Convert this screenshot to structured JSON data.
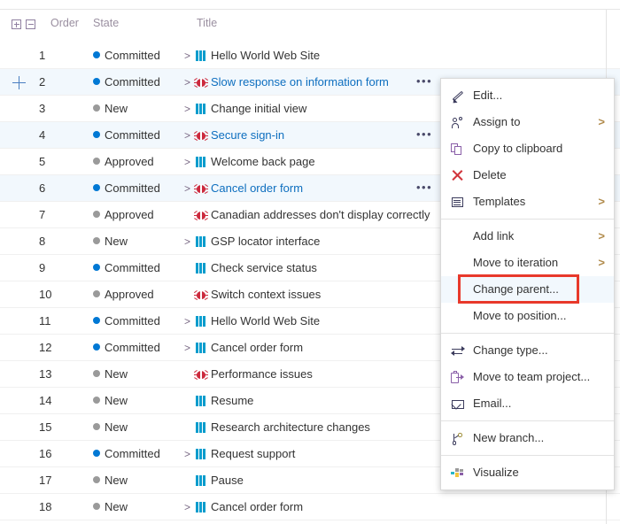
{
  "grid": {
    "header": {
      "expand_all_icon": "plus-box-icon",
      "collapse_all_icon": "minus-box-icon",
      "order_label": "Order",
      "state_label": "State",
      "title_label": "Title"
    },
    "state_colors": {
      "Committed": "#0078d4",
      "New": "#9a9a9a",
      "Approved": "#9a9a9a"
    },
    "rows": [
      {
        "order": "1",
        "state": "Committed",
        "chevron": ">",
        "type": "pbi",
        "title": "Hello World Web Site",
        "link": false,
        "ellipsis": "",
        "selected": false,
        "expander": false
      },
      {
        "order": "2",
        "state": "Committed",
        "chevron": ">",
        "type": "bug",
        "title": "Slow response on information form",
        "link": true,
        "ellipsis": "•••",
        "selected": true,
        "expander": true
      },
      {
        "order": "3",
        "state": "New",
        "chevron": ">",
        "type": "pbi",
        "title": "Change initial view",
        "link": false,
        "ellipsis": "",
        "selected": false,
        "expander": false
      },
      {
        "order": "4",
        "state": "Committed",
        "chevron": ">",
        "type": "bug",
        "title": "Secure sign-in",
        "link": true,
        "ellipsis": "•••",
        "selected": true,
        "expander": false
      },
      {
        "order": "5",
        "state": "Approved",
        "chevron": ">",
        "type": "pbi",
        "title": "Welcome back page",
        "link": false,
        "ellipsis": "",
        "selected": false,
        "expander": false
      },
      {
        "order": "6",
        "state": "Committed",
        "chevron": ">",
        "type": "bug",
        "title": "Cancel order form",
        "link": true,
        "ellipsis": "•••",
        "selected": true,
        "expander": false
      },
      {
        "order": "7",
        "state": "Approved",
        "chevron": "",
        "type": "bug",
        "title": "Canadian addresses don't display correctly",
        "link": false,
        "ellipsis": "",
        "selected": false,
        "expander": false
      },
      {
        "order": "8",
        "state": "New",
        "chevron": ">",
        "type": "pbi",
        "title": "GSP locator interface",
        "link": false,
        "ellipsis": "",
        "selected": false,
        "expander": false
      },
      {
        "order": "9",
        "state": "Committed",
        "chevron": "",
        "type": "pbi",
        "title": "Check service status",
        "link": false,
        "ellipsis": "",
        "selected": false,
        "expander": false
      },
      {
        "order": "10",
        "state": "Approved",
        "chevron": "",
        "type": "bug",
        "title": "Switch context issues",
        "link": false,
        "ellipsis": "",
        "selected": false,
        "expander": false
      },
      {
        "order": "11",
        "state": "Committed",
        "chevron": ">",
        "type": "pbi",
        "title": "Hello World Web Site",
        "link": false,
        "ellipsis": "",
        "selected": false,
        "expander": false
      },
      {
        "order": "12",
        "state": "Committed",
        "chevron": ">",
        "type": "pbi",
        "title": "Cancel order form",
        "link": false,
        "ellipsis": "",
        "selected": false,
        "expander": false
      },
      {
        "order": "13",
        "state": "New",
        "chevron": "",
        "type": "bug",
        "title": "Performance issues",
        "link": false,
        "ellipsis": "",
        "selected": false,
        "expander": false
      },
      {
        "order": "14",
        "state": "New",
        "chevron": "",
        "type": "pbi",
        "title": "Resume",
        "link": false,
        "ellipsis": "",
        "selected": false,
        "expander": false
      },
      {
        "order": "15",
        "state": "New",
        "chevron": "",
        "type": "pbi",
        "title": "Research architecture changes",
        "link": false,
        "ellipsis": "",
        "selected": false,
        "expander": false
      },
      {
        "order": "16",
        "state": "Committed",
        "chevron": ">",
        "type": "pbi",
        "title": "Request support",
        "link": false,
        "ellipsis": "",
        "selected": false,
        "expander": false
      },
      {
        "order": "17",
        "state": "New",
        "chevron": "",
        "type": "pbi",
        "title": "Pause",
        "link": false,
        "ellipsis": "",
        "selected": false,
        "expander": false
      },
      {
        "order": "18",
        "state": "New",
        "chevron": ">",
        "type": "pbi",
        "title": "Cancel order form",
        "link": false,
        "ellipsis": "",
        "selected": false,
        "expander": false
      }
    ]
  },
  "context_menu": {
    "highlight_color": "#e8392b",
    "items": [
      {
        "label": "Edit...",
        "icon": "pencil-icon",
        "submenu": "",
        "separator_after": false,
        "highlighted": false,
        "boxed": false
      },
      {
        "label": "Assign to",
        "icon": "person-add-icon",
        "submenu": ">",
        "separator_after": false,
        "highlighted": false,
        "boxed": false
      },
      {
        "label": "Copy to clipboard",
        "icon": "copy-icon",
        "submenu": "",
        "separator_after": false,
        "highlighted": false,
        "boxed": false
      },
      {
        "label": "Delete",
        "icon": "delete-x-icon",
        "submenu": "",
        "separator_after": false,
        "highlighted": false,
        "boxed": false
      },
      {
        "label": "Templates",
        "icon": "templates-icon",
        "submenu": ">",
        "separator_after": true,
        "highlighted": false,
        "boxed": false
      },
      {
        "label": "Add link",
        "icon": "",
        "submenu": ">",
        "separator_after": false,
        "highlighted": false,
        "boxed": false
      },
      {
        "label": "Move to iteration",
        "icon": "",
        "submenu": ">",
        "separator_after": false,
        "highlighted": false,
        "boxed": false
      },
      {
        "label": "Change parent...",
        "icon": "",
        "submenu": "",
        "separator_after": false,
        "highlighted": true,
        "boxed": true
      },
      {
        "label": "Move to position...",
        "icon": "",
        "submenu": "",
        "separator_after": true,
        "highlighted": false,
        "boxed": false
      },
      {
        "label": "Change type...",
        "icon": "change-type-icon",
        "submenu": "",
        "separator_after": false,
        "highlighted": false,
        "boxed": false
      },
      {
        "label": "Move to team project...",
        "icon": "move-project-icon",
        "submenu": "",
        "separator_after": false,
        "highlighted": false,
        "boxed": false
      },
      {
        "label": "Email...",
        "icon": "email-icon",
        "submenu": "",
        "separator_after": true,
        "highlighted": false,
        "boxed": false
      },
      {
        "label": "New branch...",
        "icon": "branch-icon",
        "submenu": "",
        "separator_after": true,
        "highlighted": false,
        "boxed": false
      },
      {
        "label": "Visualize",
        "icon": "visualize-icon",
        "submenu": "",
        "separator_after": false,
        "highlighted": false,
        "boxed": false
      }
    ]
  }
}
